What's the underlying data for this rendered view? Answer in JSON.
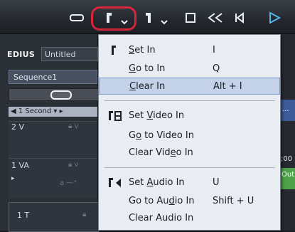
{
  "toolbar": {
    "buttons": [
      "set-in-button",
      "set-in-menu-arrow",
      "set-out-button",
      "set-out-menu-arrow",
      "stop-button",
      "rewind-button",
      "step-back-button",
      "play-button"
    ]
  },
  "left_panel": {
    "app_name": "EDIUS",
    "project_name": "Untitled",
    "sequence_tab": "Sequence1",
    "timescale": "1 Second",
    "tracks": [
      {
        "label": "2 V"
      },
      {
        "label": "1 VA"
      },
      {
        "label": "1 T"
      }
    ]
  },
  "right_strip": {
    "frag1": "...",
    "frag2": ";00",
    "frag3": "Out"
  },
  "menu": {
    "items": [
      {
        "label_pre": "",
        "label_u": "S",
        "label_post": "et In",
        "shortcut": "I"
      },
      {
        "label_pre": "",
        "label_u": "G",
        "label_post": "o to In",
        "shortcut": "Q"
      },
      {
        "label_pre": "",
        "label_u": "C",
        "label_post": "lear In",
        "shortcut": "Alt + I"
      },
      {
        "label_pre": "Set ",
        "label_u": "V",
        "label_post": "ideo In",
        "shortcut": ""
      },
      {
        "label_pre": "G",
        "label_u": "o",
        "label_post": " to Video In",
        "shortcut": ""
      },
      {
        "label_pre": "Clear Vid",
        "label_u": "e",
        "label_post": "o In",
        "shortcut": ""
      },
      {
        "label_pre": "Set ",
        "label_u": "A",
        "label_post": "udio In",
        "shortcut": "U"
      },
      {
        "label_pre": "Go to Au",
        "label_u": "d",
        "label_post": "io In",
        "shortcut": "Shift + U"
      },
      {
        "label_pre": "Clear Audio In",
        "label_u": "",
        "label_post": "",
        "shortcut": ""
      }
    ],
    "selected_index": 2
  },
  "colors": {
    "highlight_ring": "#d8253a",
    "menu_bg": "#e9ecf1",
    "menu_selected": "#c3d2e9",
    "play": "#4fb7e8"
  }
}
